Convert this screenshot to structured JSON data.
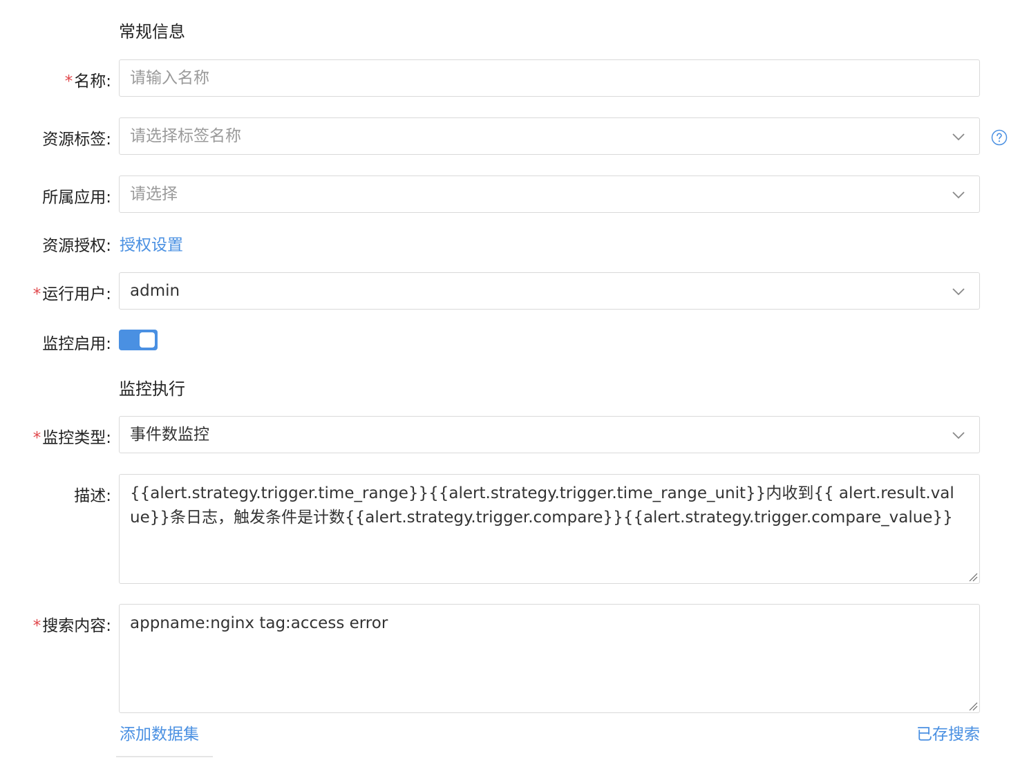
{
  "sections": {
    "general": "常规信息",
    "execution": "监控执行"
  },
  "form": {
    "name": {
      "required_mark": "*",
      "label": "名称:",
      "placeholder": "请输入名称",
      "value": ""
    },
    "resource_tag": {
      "label": "资源标签:",
      "placeholder": "请选择标签名称",
      "help_icon": "question-circle-icon"
    },
    "app": {
      "label": "所属应用:",
      "placeholder": "请选择"
    },
    "resource_auth": {
      "label": "资源授权:",
      "link": "授权设置"
    },
    "run_user": {
      "required_mark": "*",
      "label": "运行用户:",
      "value": "admin"
    },
    "monitor_enabled": {
      "label": "监控启用:",
      "enabled": true
    },
    "monitor_type": {
      "required_mark": "*",
      "label": "监控类型:",
      "value": "事件数监控"
    },
    "description": {
      "label": "描述:",
      "value": "{{alert.strategy.trigger.time_range}}{{alert.strategy.trigger.time_range_unit}}内收到{{ alert.result.value}}条日志，触发条件是计数{{alert.strategy.trigger.compare}}{{alert.strategy.trigger.compare_value}}"
    },
    "search_content": {
      "required_mark": "*",
      "label": "搜索内容:",
      "value": "appname:nginx tag:access error"
    },
    "add_dataset_link": "添加数据集",
    "saved_search_link": "已存搜索"
  },
  "colors": {
    "accent": "#4a90e2",
    "required": "#e0464a",
    "border": "#d9d9d9",
    "placeholder": "#9a9a9a"
  }
}
